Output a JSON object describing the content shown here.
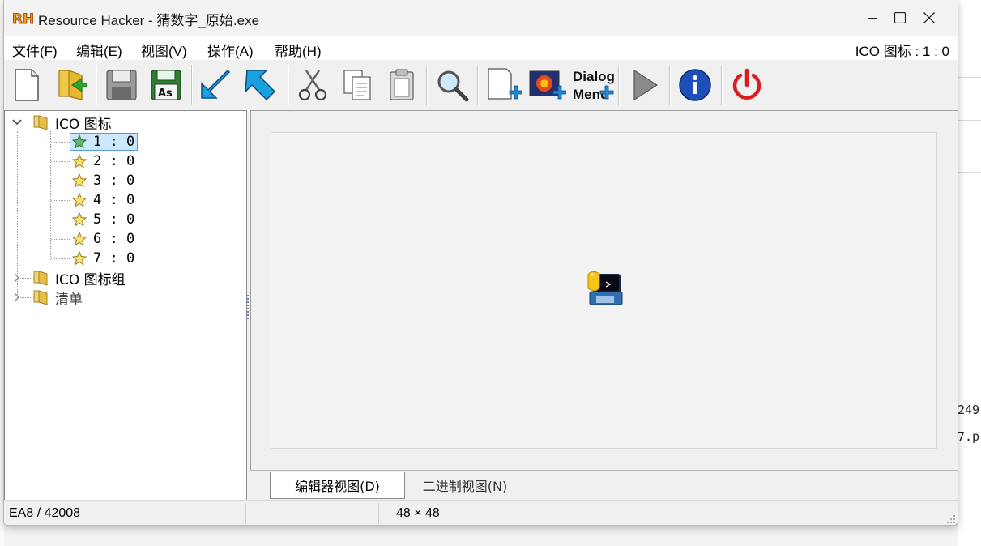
{
  "window": {
    "app_logo": "RH",
    "title": "Resource Hacker - 猜数字_原始.exe",
    "controls": {
      "minimize": "minimize-icon",
      "maximize": "maximize-icon",
      "close": "close-icon"
    }
  },
  "menubar": {
    "items": [
      {
        "label": "文件(F)"
      },
      {
        "label": "编辑(E)"
      },
      {
        "label": "视图(V)"
      },
      {
        "label": "操作(A)"
      },
      {
        "label": "帮助(H)"
      }
    ],
    "current_resource": "ICO 图标 : 1 : 0"
  },
  "toolbar": {
    "buttons": [
      {
        "icon": "new-file-icon"
      },
      {
        "icon": "open-folder-icon"
      },
      {
        "icon": "save-icon"
      },
      {
        "icon": "save-as-icon",
        "badge": "As"
      },
      {
        "icon": "compile-arrow-icon"
      },
      {
        "icon": "compile-all-icon"
      },
      {
        "icon": "cut-icon"
      },
      {
        "icon": "copy-icon"
      },
      {
        "icon": "paste-icon"
      },
      {
        "icon": "find-icon"
      },
      {
        "icon": "add-resource-icon"
      },
      {
        "icon": "add-image-icon"
      },
      {
        "icon": "add-dialog-menu-icon",
        "text_line1": "Dialog",
        "text_line2": "Menu"
      },
      {
        "icon": "run-script-icon"
      },
      {
        "icon": "about-info-icon"
      },
      {
        "icon": "exit-power-icon"
      }
    ]
  },
  "tree": {
    "root": {
      "label": "ICO 图标",
      "expanded": true
    },
    "children": [
      {
        "label": "1 : 0",
        "selected": true
      },
      {
        "label": "2 : 0"
      },
      {
        "label": "3 : 0"
      },
      {
        "label": "4 : 0"
      },
      {
        "label": "5 : 0"
      },
      {
        "label": "6 : 0"
      },
      {
        "label": "7 : 0"
      }
    ],
    "siblings": [
      {
        "label": "ICO 图标组",
        "expanded": false
      },
      {
        "label": "清单",
        "expanded": false
      }
    ]
  },
  "editor": {
    "preview_icon": "python-app-icon"
  },
  "tabs": [
    {
      "label": "编辑器视图(D)",
      "active": true
    },
    {
      "label": "二进制视图(N)",
      "active": false
    }
  ],
  "status": {
    "position": "EA8 / 42008",
    "middle": "",
    "dimensions": "48 × 48"
  },
  "background": {
    "right_text_1": "249",
    "right_text_2": "7.p"
  },
  "colors": {
    "accent": "#1e88d8",
    "selection": "#cce8ff",
    "power_red": "#d81e1e",
    "info_blue": "#1c4fb8"
  }
}
